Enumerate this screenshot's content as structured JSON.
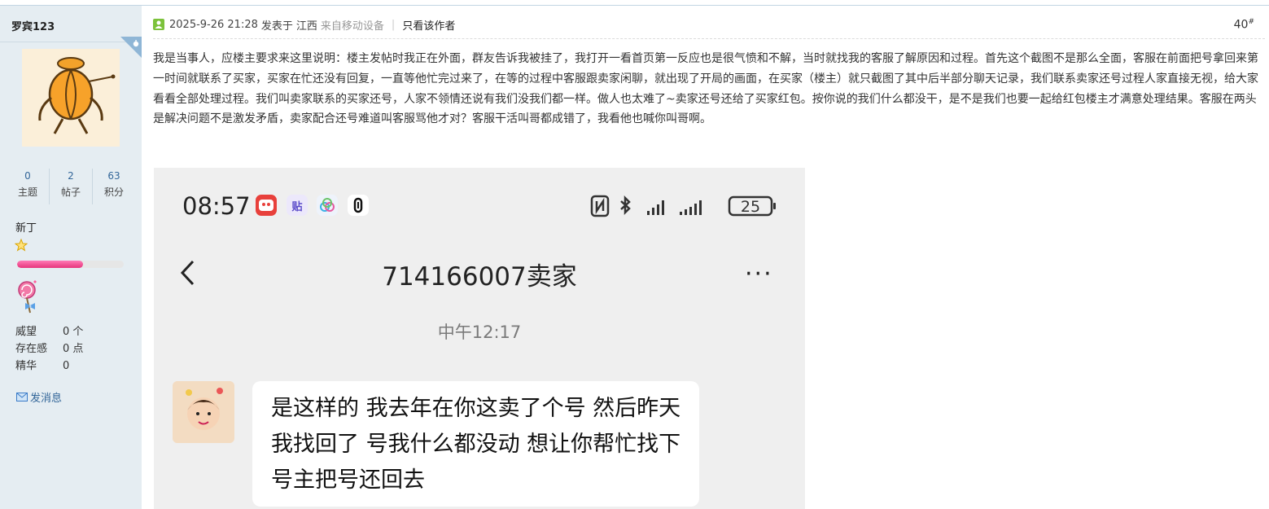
{
  "sidebar": {
    "username": "罗宾123",
    "stats": [
      {
        "value": "0",
        "label": "主题"
      },
      {
        "value": "2",
        "label": "帖子"
      },
      {
        "value": "63",
        "label": "积分"
      }
    ],
    "rank": "新丁",
    "progress": 0.62,
    "info": [
      {
        "key": "威望",
        "value": "0 个"
      },
      {
        "key": "存在感",
        "value": "0 点"
      },
      {
        "key": "精华",
        "value": "0"
      }
    ],
    "pm_label": "发消息"
  },
  "post": {
    "datetime": "2025-9-26 21:28",
    "posted_in": "发表于",
    "location": "江西",
    "device": "来自移动设备",
    "author_only": "只看该作者",
    "floor": "40",
    "floor_sup": "#",
    "text": "我是当事人，应楼主要求来这里说明：楼主发帖时我正在外面，群友告诉我被挂了，我打开一看首页第一反应也是很气愤和不解，当时就找我的客服了解原因和过程。首先这个截图不是那么全面，客服在前面把号拿回来第一时间就联系了买家，买家在忙还没有回复，一直等他忙完过来了，在等的过程中客服跟卖家闲聊，就出现了开局的画面，在买家（楼主）就只截图了其中后半部分聊天记录，我们联系卖家还号过程人家直接无视，给大家看看全部处理过程。我们叫卖家联系的买家还号，人家不领情还说有我们没我们都一样。做人也太难了~卖家还号还给了买家红包。按你说的我们什么都没干，是不是我们也要一起给红包楼主才满意处理结果。客服在两头是解决问题不是激发矛盾，卖家配合还号难道叫客服骂他才对？客服干活叫哥都成错了，我看他也喊你叫哥啊。"
  },
  "screenshot": {
    "time": "08:57",
    "app_icon_tie": "贴",
    "battery": "25",
    "chat_title": "714166007卖家",
    "more": "···",
    "timestamp": "中午12:17",
    "message": "是这样的 我去年在你这卖了个号 然后昨天我找回了 号我什么都没动 想让你帮忙找下号主把号还回去"
  },
  "colors": {
    "sidebar_bg": "#e5edf2",
    "link": "#336699",
    "progress_fill": "#e6357c",
    "chat_bg": "#efefef"
  }
}
